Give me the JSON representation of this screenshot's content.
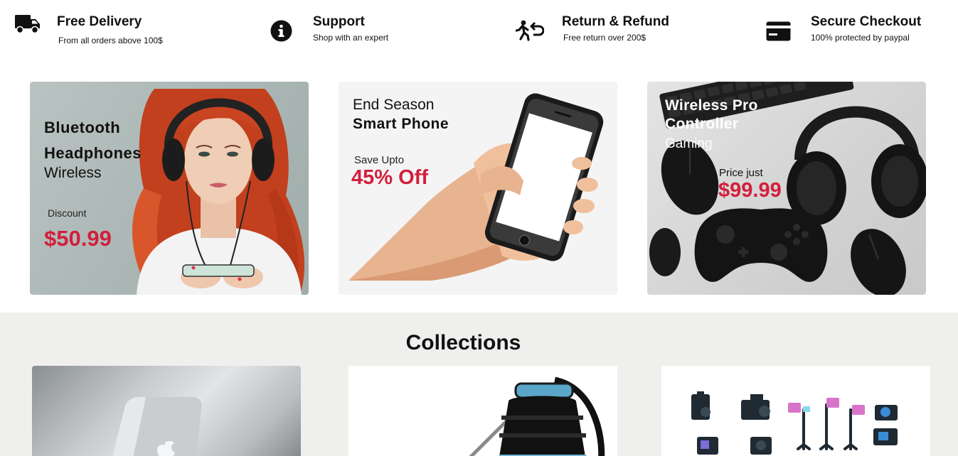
{
  "features": [
    {
      "icon": "truck-icon",
      "title": "Free Delivery",
      "subtitle": "From all orders above 100$"
    },
    {
      "icon": "info-icon",
      "title": "Support",
      "subtitle": "Shop with an expert"
    },
    {
      "icon": "return-icon",
      "title": "Return & Refund",
      "subtitle": "Free return over 200$"
    },
    {
      "icon": "credit-card-icon",
      "title": "Secure Checkout",
      "subtitle": "100% protected by paypal"
    }
  ],
  "banners": [
    {
      "line1": "Bluetooth",
      "line2": "Headphones",
      "line3": "Wireless",
      "price_label": "Discount",
      "price": "$50.99"
    },
    {
      "line1": "End Season",
      "line2": "Smart Phone",
      "offer_label": "Save Upto",
      "offer": "45% Off"
    },
    {
      "line1": "Wireless Pro",
      "line2": "Controller",
      "line3": "Gaming",
      "price_label": "Price just",
      "price": "$99.99"
    }
  ],
  "collections": {
    "title": "Collections",
    "items": [
      {
        "image": "laptop"
      },
      {
        "image": "vacuum-cleaner"
      },
      {
        "image": "camera-gimbals"
      }
    ]
  },
  "colors": {
    "accent_price": "#d21f3c",
    "section_bg": "#efefed"
  }
}
